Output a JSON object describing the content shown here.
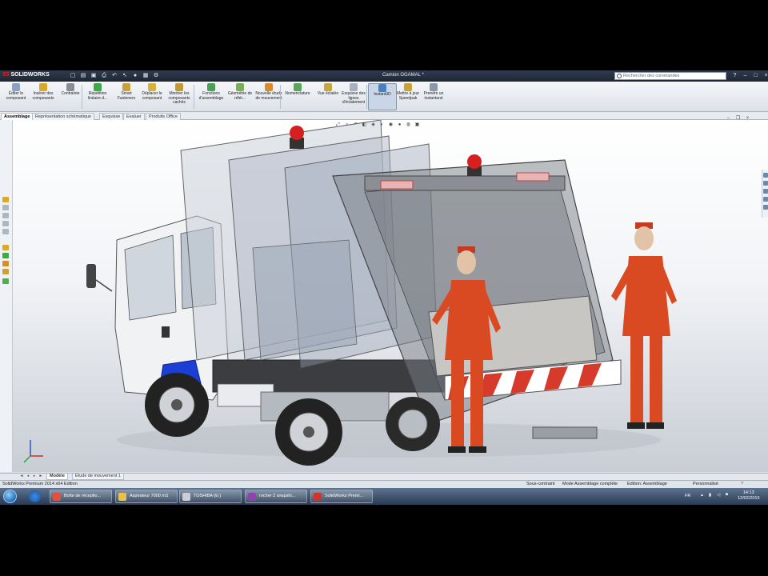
{
  "app": {
    "logo_prefix": "3S",
    "logo_name": "SOLIDWORKS",
    "doc_title": "Camion OGAMAL *",
    "search_placeholder": "Rechercher des commandes"
  },
  "command_manager": {
    "items": [
      {
        "label": "Éditer le composant",
        "icon": "edit-component-icon",
        "color": "#8aa1c1"
      },
      {
        "label": "Insérer des composants",
        "icon": "insert-components-icon",
        "color": "#d9a92c"
      },
      {
        "label": "Contrainte",
        "icon": "mate-icon",
        "color": "#8a8f96"
      },
      {
        "label": "Répétition linéaire d...",
        "icon": "linear-pattern-icon",
        "color": "#3fa94a"
      },
      {
        "label": "Smart Fasteners",
        "icon": "smart-fasteners-icon",
        "color": "#c8a13a"
      },
      {
        "label": "Déplacer le composant",
        "icon": "move-component-icon",
        "color": "#d6b23a"
      },
      {
        "label": "Montrer les composants cachés",
        "icon": "show-hidden-icon",
        "color": "#c29a35"
      },
      {
        "label": "Fonctions d'assemblage",
        "icon": "assembly-features-icon",
        "color": "#4aa055"
      },
      {
        "label": "Géométrie de référ...",
        "icon": "reference-geometry-icon",
        "color": "#7ab055"
      },
      {
        "label": "Nouvelle étude de mouvement",
        "icon": "new-motion-study-icon",
        "color": "#d98c2a"
      },
      {
        "label": "Nomenclature",
        "icon": "bom-icon",
        "color": "#5aa55a"
      },
      {
        "label": "Vue éclatée",
        "icon": "exploded-view-icon",
        "color": "#c5a63f"
      },
      {
        "label": "Esquisse des lignes d'éclatement",
        "icon": "explode-line-sketch-icon",
        "color": "#a7b1bd"
      },
      {
        "label": "Instant3D",
        "icon": "instant3d-icon",
        "color": "#4b7fc0"
      },
      {
        "label": "Mettre à jour Speedpak",
        "icon": "update-speedpak-icon",
        "color": "#c7a43b"
      },
      {
        "label": "Prendre un instantané",
        "icon": "snapshot-icon",
        "color": "#8b97a6"
      }
    ]
  },
  "tabs": [
    {
      "label": "Assemblage"
    },
    {
      "label": "Représentation schématique"
    },
    {
      "label": "Esquisse"
    },
    {
      "label": "Evaluer"
    },
    {
      "label": "Produits Office"
    }
  ],
  "bottom_tabs": [
    {
      "label": "Modèle"
    },
    {
      "label": "Etude de mouvement 1"
    }
  ],
  "status": {
    "left": "SolidWorks Premium 2014 x64 Edition",
    "constraint": "Sous-contraint",
    "mode": "Mode Assemblage complète",
    "editing": "Edition: Assemblage",
    "custom": "Personnalisé"
  },
  "taskbar": {
    "items": [
      {
        "label": "Boîte de réceptio...",
        "icon": "chrome-icon",
        "color": "#e74c3c"
      },
      {
        "label": "Aspirateur 7000 m3",
        "icon": "folder-icon",
        "color": "#e8c14a"
      },
      {
        "label": "TOSHIBA (E:)",
        "icon": "drive-icon",
        "color": "#c9ced6"
      },
      {
        "label": "rocher 2 snapshi...",
        "icon": "winrar-icon",
        "color": "#8e44ad"
      },
      {
        "label": "SolidWorks Premi...",
        "icon": "solidworks-icon",
        "color": "#d0342c"
      }
    ],
    "lang": "FR",
    "time": "14:13",
    "date": "12/02/2015"
  },
  "colors": {
    "accent": "#1f6fb8",
    "beacon": "#d61f1f",
    "figure": "#d94a22",
    "cab_blue": "#1b3fd4"
  }
}
